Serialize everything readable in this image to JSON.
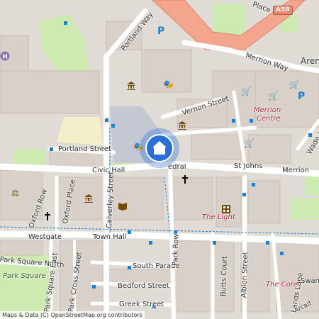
{
  "map": {
    "attribution": "Maps & Data (C) OpenStreetMap.org contributors",
    "road_shield": "A58",
    "streets": {
      "portland_way": "Portland Way",
      "merrion_way": "Merrion Way",
      "vernon_street": "Vernon Street",
      "portland_street": "Portland Street",
      "civic_hall": "Civic Hall",
      "st_johns": "St Johns",
      "merrion": "Merrion",
      "oxford_row": "Oxford Row",
      "oxford_place": "Oxford Place",
      "calverley_street": "Calverley Street",
      "westgate": "Westgate",
      "town_hall": "Town Hall",
      "park_square_north": "Park Square North",
      "park_square_east": "Park Square East",
      "park_square": "Park Square",
      "park_cross_street": "Park Cross Street",
      "south_parade": "South Parade",
      "park_row": "Park Row",
      "bedford_street": "Bedford Street",
      "butts_court": "Butts Court",
      "albion_street": "Albion Street",
      "greek_street": "Greek Street",
      "wade_lane": "Wade La",
      "lands_lane": "Lands Lane",
      "swan": "Swan",
      "place_partial": "Place",
      "aren_partial": "Aren",
      "cathedral_partial": "edral",
      "arcade_partial": "Arcad"
    },
    "places": {
      "merrion_centre_line1": "Merrion",
      "merrion_centre_line2": "Centre",
      "the_light": "The Light",
      "the_core": "The Core"
    },
    "icons": {
      "pin": "home-icon",
      "parking": "parking-icon",
      "theatre": "theatre-icon",
      "museum": "museum-icon",
      "church": "church-icon",
      "shopping": "shopping-cart-icon",
      "library": "library-icon",
      "courthouse": "courthouse-icon",
      "cinema": "cinema-icon",
      "hospital": "hospital-icon"
    },
    "colors": {
      "background": "#e0dbd4",
      "building": "#d9d0c9",
      "motorway": "#f4a58e",
      "road": "#ffffff",
      "park": "#cdebb0",
      "plaza": "#c4c8d3",
      "pin": "#2a6fd6",
      "poi_text": "#b0293b",
      "transit": "#1e7fd0"
    }
  }
}
